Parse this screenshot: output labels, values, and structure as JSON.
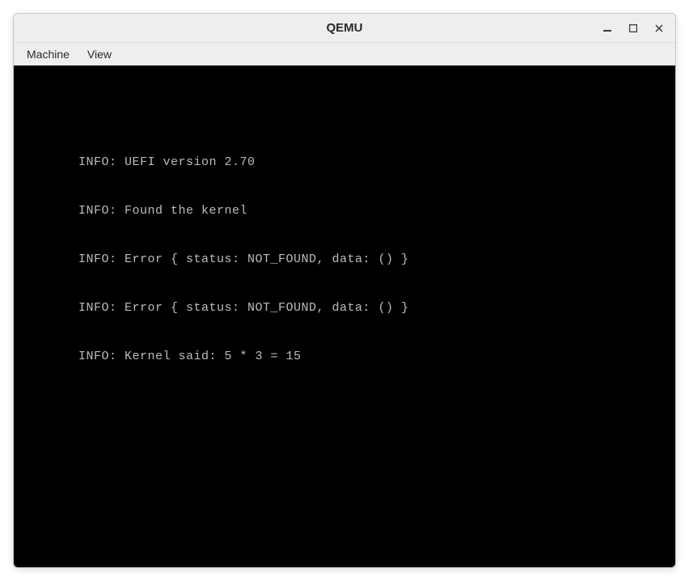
{
  "window": {
    "title": "QEMU"
  },
  "menubar": {
    "items": [
      "Machine",
      "View"
    ]
  },
  "terminal": {
    "lines": [
      "INFO: UEFI version 2.70",
      "INFO: Found the kernel",
      "INFO: Error { status: NOT_FOUND, data: () }",
      "INFO: Error { status: NOT_FOUND, data: () }",
      "INFO: Kernel said: 5 * 3 = 15"
    ]
  }
}
